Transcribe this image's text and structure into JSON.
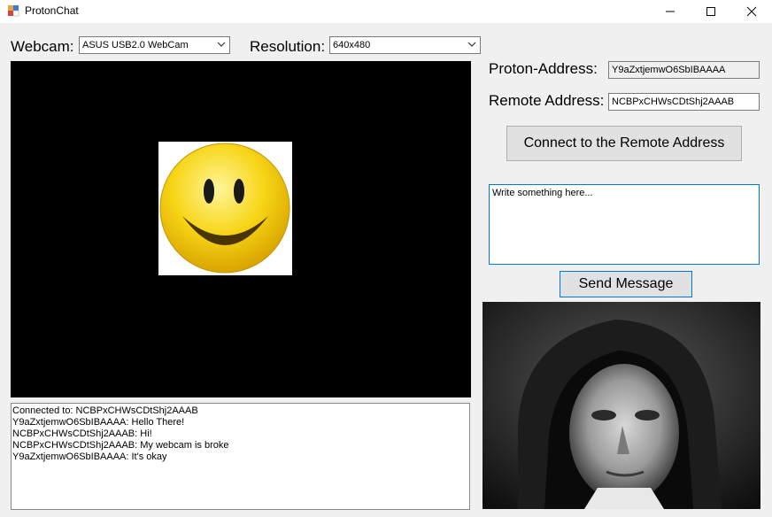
{
  "window": {
    "title": "ProtonChat",
    "minimize_icon": "minimize-icon",
    "maximize_icon": "maximize-icon",
    "close_icon": "close-icon"
  },
  "webcam": {
    "label": "Webcam:",
    "selected": "ASUS USB2.0 WebCam"
  },
  "resolution": {
    "label": "Resolution:",
    "selected": "640x480"
  },
  "video_preview": {
    "icon": "smiley-face-icon"
  },
  "chat_log": {
    "lines": [
      "Connected to: NCBPxCHWsCDtShj2AAAB",
      "Y9aZxtjemwO6SbIBAAAA: Hello There!",
      "NCBPxCHWsCDtShj2AAAB: Hi!",
      "NCBPxCHWsCDtShj2AAAB: My webcam is broke",
      "Y9aZxtjemwO6SbIBAAAA: It's okay"
    ]
  },
  "proton_address": {
    "label": "Proton-Address:",
    "value": "Y9aZxtjemwO6SbIBAAAA"
  },
  "remote_address": {
    "label": "Remote Address:",
    "value": "NCBPxCHWsCDtShj2AAAB"
  },
  "connect_button": {
    "label": "Connect to the Remote Address"
  },
  "message_box": {
    "placeholder": "Write something here..."
  },
  "send_button": {
    "label": "Send Message"
  },
  "remote_video": {
    "content": "person-in-hood-photo"
  },
  "colors": {
    "focus_border": "#0078d7",
    "button_face": "#e1e1e1",
    "window_bg": "#f0f0f0"
  }
}
